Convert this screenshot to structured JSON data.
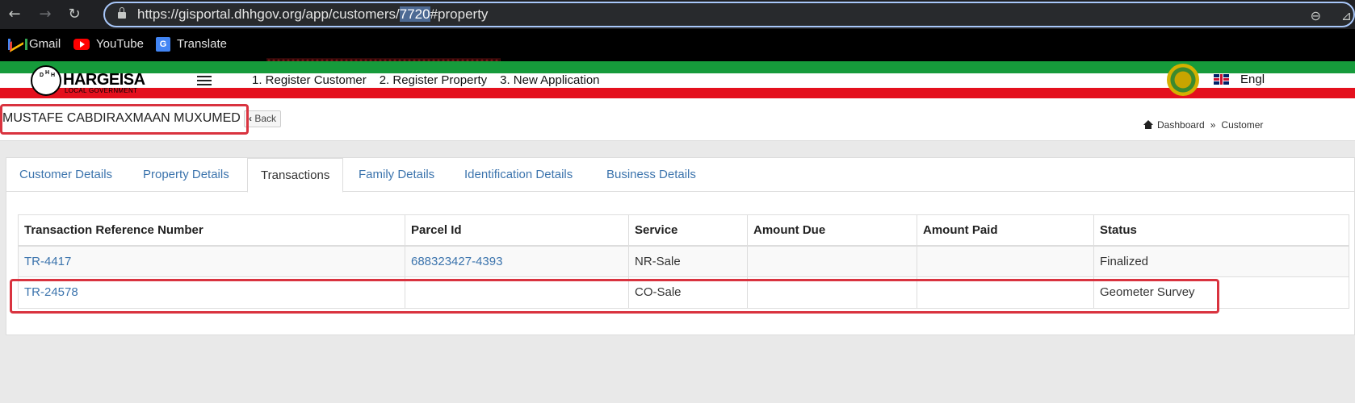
{
  "browser": {
    "url_before": "https://gisportal.dhhgov.org/app/customers/",
    "url_selected": "7720",
    "url_after": "#property",
    "bookmarks": [
      {
        "label": "Gmail",
        "icon": "gmail-icon"
      },
      {
        "label": "YouTube",
        "icon": "youtube-icon"
      },
      {
        "label": "Translate",
        "icon": "translate-icon"
      }
    ]
  },
  "header": {
    "logo_title": "HARGEISA",
    "logo_subtitle": "LOCAL GOVERNMENT",
    "logo_letters": [
      "D",
      "H",
      "H"
    ],
    "nav": [
      "1. Register Customer",
      "2. Register Property",
      "3. New Application"
    ],
    "language": "Engl"
  },
  "titlebar": {
    "customer_name": "MUSTAFE CABDIRAXMAAN MUXUMED",
    "back_label": "Back",
    "breadcrumb": [
      "Dashboard",
      "Customer"
    ]
  },
  "tabs": [
    {
      "label": "Customer Details",
      "active": false
    },
    {
      "label": "Property Details",
      "active": false
    },
    {
      "label": "Transactions",
      "active": true
    },
    {
      "label": "Family Details",
      "active": false
    },
    {
      "label": "Identification Details",
      "active": false
    },
    {
      "label": "Business Details",
      "active": false
    }
  ],
  "transactions": {
    "columns": [
      "Transaction Reference Number",
      "Parcel Id",
      "Service",
      "Amount Due",
      "Amount Paid",
      "Status"
    ],
    "rows": [
      {
        "ref": "TR-4417",
        "parcel": "688323427-4393",
        "service": "NR-Sale",
        "due": "",
        "paid": "",
        "status": "Finalized"
      },
      {
        "ref": "TR-24578",
        "parcel": "",
        "service": "CO-Sale",
        "due": "",
        "paid": "",
        "status": "Geometer Survey"
      }
    ]
  },
  "colors": {
    "link": "#3c74ad",
    "header_green": "#169b3b",
    "header_red": "#e4101d",
    "annotation_red": "#d9333f"
  }
}
